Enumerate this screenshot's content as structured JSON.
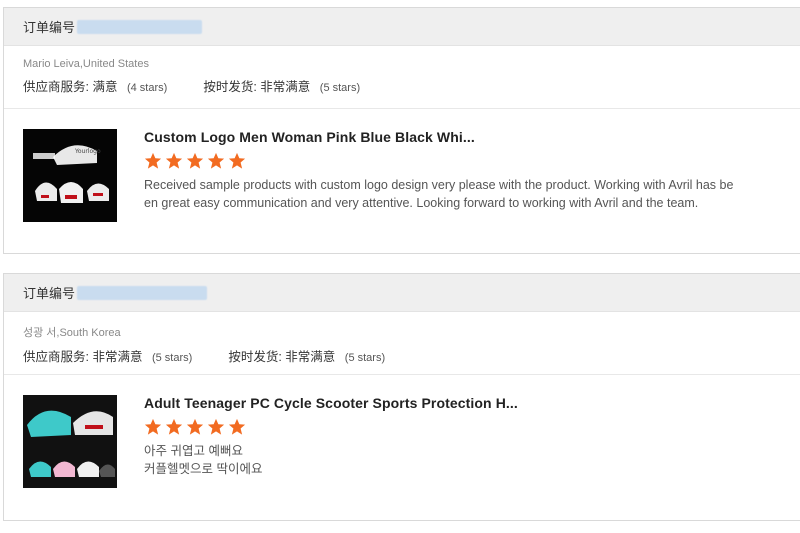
{
  "orders": [
    {
      "order_label": "订单编号",
      "buyer": "Mario Leiva,United States",
      "supplier_service_label": "供应商服务:",
      "supplier_service_value": "满意",
      "supplier_service_stars": "(4 stars)",
      "on_time_label": "按时发货:",
      "on_time_value": "非常满意",
      "on_time_stars": "(5 stars)",
      "product_title": "Custom Logo Men Woman Pink Blue Black Whi...",
      "rating": 5,
      "review_lines": [
        "Received sample products with custom logo design very please with the product. Working with Avril has be",
        "en great easy communication and very attentive. Looking forward to working with Avril and the team."
      ]
    },
    {
      "order_label": "订单编号",
      "buyer": "성광 서,South Korea",
      "supplier_service_label": "供应商服务:",
      "supplier_service_value": "非常满意",
      "supplier_service_stars": "(5 stars)",
      "on_time_label": "按时发货:",
      "on_time_value": "非常满意",
      "on_time_stars": "(5 stars)",
      "product_title": "Adult Teenager PC Cycle Scooter Sports Protection H...",
      "rating": 5,
      "review_lines": [
        "아주 귀엽고 예뻐요",
        "커플헬멧으로 딱이에요"
      ]
    }
  ],
  "colors": {
    "star": "#f26b21",
    "header_bg": "#efefef",
    "blur": "#c9dcef"
  },
  "icons": {
    "star": "star-icon",
    "product_image": "helmet-product-image"
  }
}
